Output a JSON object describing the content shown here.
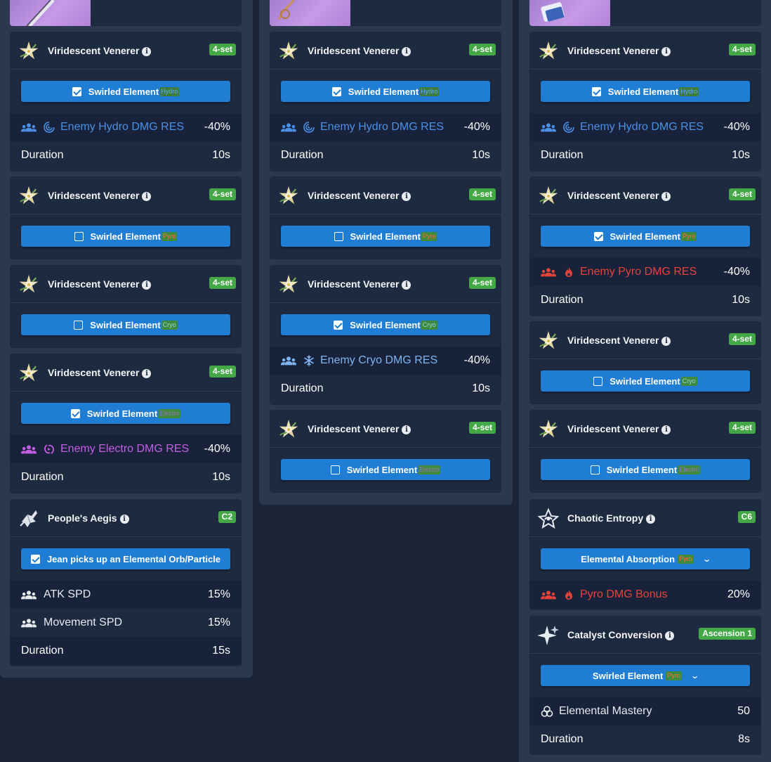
{
  "colors": {
    "page_bg": "#1b2537",
    "column_bg": "#2b3850",
    "card_bg": "#1e2a40",
    "button": "#1f7dd4",
    "badge": "#44a846",
    "hydro": "#4a90e6",
    "pyro": "#e5433a",
    "cryo": "#7fb4ef",
    "electro": "#c35fe3"
  },
  "common": {
    "vv_title": "Viridescent Venerer",
    "vv_badge": "4-set",
    "swirled_element": "Swirled Element",
    "duration": "Duration",
    "tag_hydro": "Hydro",
    "tag_pyro": "Pyro",
    "tag_cryo": "Cryo",
    "tag_electro": "Electro",
    "res_value": "-40%",
    "dur_10s": "10s"
  },
  "col1": {
    "card1": {
      "checked": true,
      "stat_label": "Enemy Hydro DMG RES"
    },
    "card2": {
      "checked": false
    },
    "card3": {
      "checked": false
    },
    "card4": {
      "checked": true,
      "stat_label": "Enemy Electro DMG RES"
    },
    "card5": {
      "title": "People's Aegis",
      "badge": "C2",
      "button_label": "Jean picks up an Elemental Orb/Particle",
      "rows": [
        {
          "label": "ATK SPD",
          "value": "15%"
        },
        {
          "label": "Movement SPD",
          "value": "15%"
        },
        {
          "label": "Duration",
          "value": "15s"
        }
      ]
    }
  },
  "col2": {
    "card1": {
      "checked": true,
      "stat_label": "Enemy Hydro DMG RES"
    },
    "card2": {
      "checked": false
    },
    "card3": {
      "checked": true,
      "stat_label": "Enemy Cryo DMG RES"
    },
    "card4": {
      "checked": false
    }
  },
  "col3": {
    "card1": {
      "checked": true,
      "stat_label": "Enemy Hydro DMG RES"
    },
    "card2": {
      "checked": true,
      "stat_label": "Enemy Pyro DMG RES"
    },
    "card3": {
      "checked": false
    },
    "card4": {
      "checked": false
    },
    "card5": {
      "title": "Chaotic Entropy",
      "badge": "C6",
      "button_label": "Elemental Absorption",
      "button_tag": "Pyro",
      "stat_label": "Pyro DMG Bonus",
      "stat_value": "20%"
    },
    "card6": {
      "title": "Catalyst Conversion",
      "badge": "Ascension 1",
      "button_label": "Swirled Element",
      "button_tag": "Pyro",
      "rows": [
        {
          "label": "Elemental Mastery",
          "value": "50"
        },
        {
          "label": "Duration",
          "value": "8s"
        }
      ]
    }
  }
}
